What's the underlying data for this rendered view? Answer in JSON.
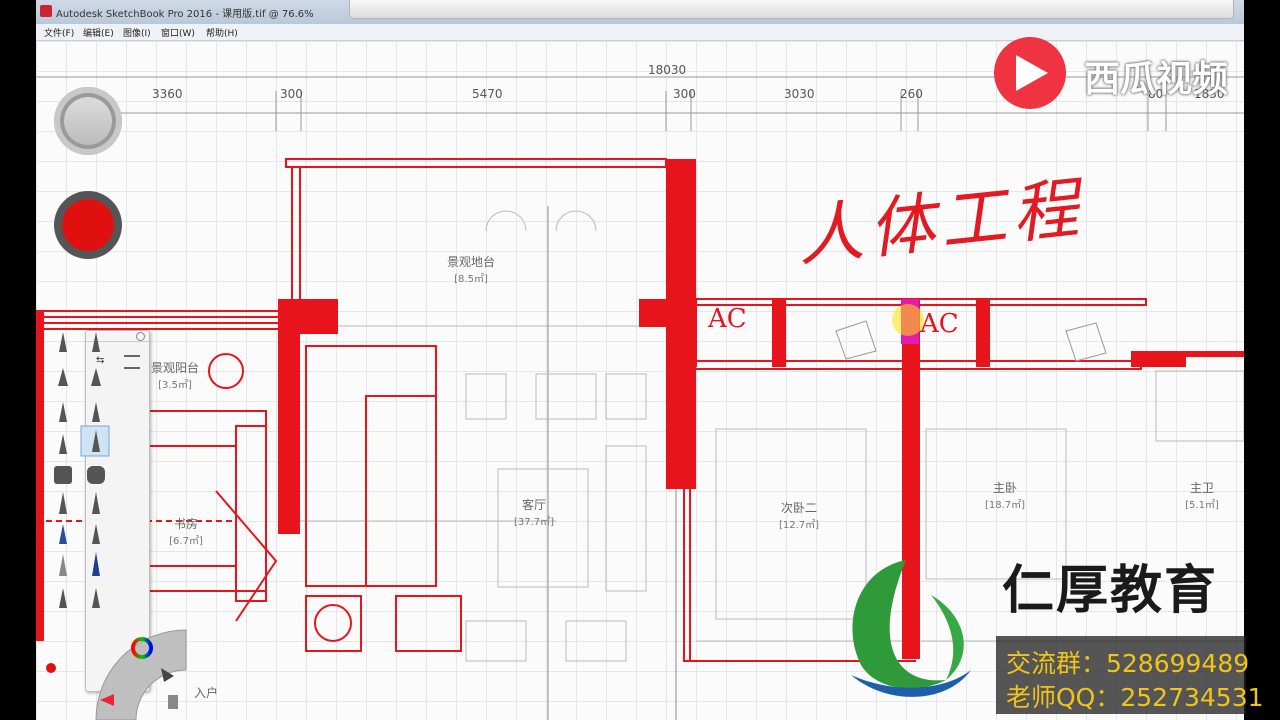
{
  "window": {
    "title": "Autodesk SketchBook Pro 2016 - 课用版.tif @ 76.6%"
  },
  "menu": [
    "文件(F)",
    "编辑(E)",
    "图像(I)",
    "窗口(W)",
    "帮助(H)"
  ],
  "dimensions": {
    "total": "18030",
    "segments": [
      "3360",
      "300",
      "5470",
      "300",
      "3030",
      "260",
      "80",
      "1830"
    ]
  },
  "rooms": [
    {
      "name": "景观地台",
      "area": "[8.5㎡]"
    },
    {
      "name": "景观阳台",
      "area": "[3.5㎡]"
    },
    {
      "name": "书房",
      "area": "[6.7㎡]"
    },
    {
      "name": "客厅",
      "area": "[37.7㎡]"
    },
    {
      "name": "次卧二",
      "area": "[12.7㎡]"
    },
    {
      "name": "主卧",
      "area": "[18.7㎡]"
    },
    {
      "name": "主卫",
      "area": "[5.1㎡]"
    },
    {
      "name": "入户",
      "area": ""
    }
  ],
  "annotations": {
    "ac_1": "AC",
    "ac_2": "AC",
    "handwriting": "人体工程"
  },
  "overlay": {
    "watermark": "西瓜视频",
    "brand": "仁厚教育",
    "group_line": "交流群：528699489",
    "qq_line": "老师QQ：252734531"
  },
  "colors": {
    "wall_red": "#e8141c",
    "brand_green": "#2e9a3a",
    "brand_blue": "#1d5fa8",
    "info_yellow": "#f0c418"
  }
}
